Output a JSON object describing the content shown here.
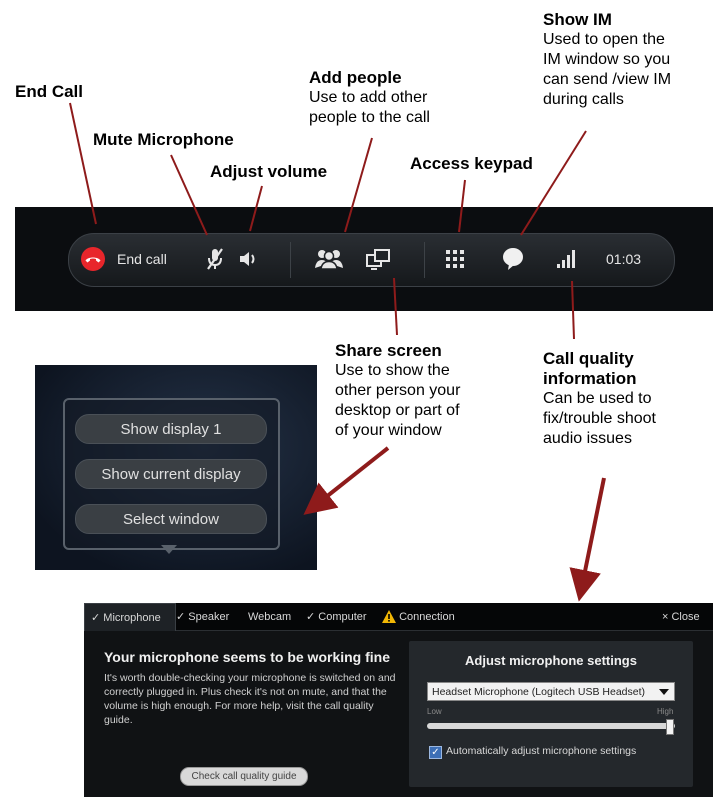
{
  "annotations": {
    "end_call": {
      "title": "End Call"
    },
    "mute": {
      "title": "Mute Microphone"
    },
    "volume": {
      "title": "Adjust volume"
    },
    "add_people": {
      "title": "Add people",
      "lines": [
        "Use to add other",
        "people to the call"
      ]
    },
    "keypad": {
      "title": "Access keypad"
    },
    "show_im": {
      "title": "Show IM",
      "lines": [
        "Used to open the",
        "IM window so you",
        "can send /view IM",
        "during calls"
      ]
    },
    "share_screen": {
      "title": "Share screen",
      "lines": [
        "Use to show the",
        "other person your",
        "desktop or part of",
        "of your window"
      ]
    },
    "call_quality": {
      "title_lines": [
        "Call quality",
        "information"
      ],
      "lines": [
        "Can be used to",
        "fix/trouble shoot",
        "audio issues"
      ]
    }
  },
  "call_bar": {
    "end_call_label": "End call",
    "timer": "01:03",
    "icons": [
      "end-call-phone-icon",
      "mute-microphone-icon",
      "speaker-volume-icon",
      "add-people-icon",
      "share-screen-icon",
      "keypad-icon",
      "im-bubble-icon",
      "signal-bars-icon"
    ],
    "colors": {
      "end_call": "#e8262b",
      "bar_bg": "#1f2327"
    }
  },
  "share_menu": {
    "options": [
      "Show display 1",
      "Show current display",
      "Select window"
    ]
  },
  "settings_panel": {
    "tabs": [
      {
        "label": "Microphone",
        "check": "✓",
        "active": true
      },
      {
        "label": "Speaker",
        "check": "✓",
        "active": false
      },
      {
        "label": "Webcam",
        "check": "",
        "active": false
      },
      {
        "label": "Computer",
        "check": "✓",
        "active": false
      },
      {
        "label": "Connection",
        "check": "",
        "warning": true,
        "active": false
      }
    ],
    "close_label": "× Close",
    "mic_status_title": "Your microphone seems to be working fine",
    "mic_status_text": "It's worth double-checking your microphone is switched on and correctly plugged in. Plus check it's not on mute, and that the volume is high enough. For more help, visit the call quality guide.",
    "guide_button": "Check call quality guide",
    "adjust_title": "Adjust microphone settings",
    "selected_device": "Headset Microphone (Logitech USB Headset)",
    "low_label": "Low",
    "high_label": "High",
    "volume_level": 0.98,
    "auto_adjust_label": "Automatically adjust microphone settings",
    "auto_adjust_checked": true
  }
}
